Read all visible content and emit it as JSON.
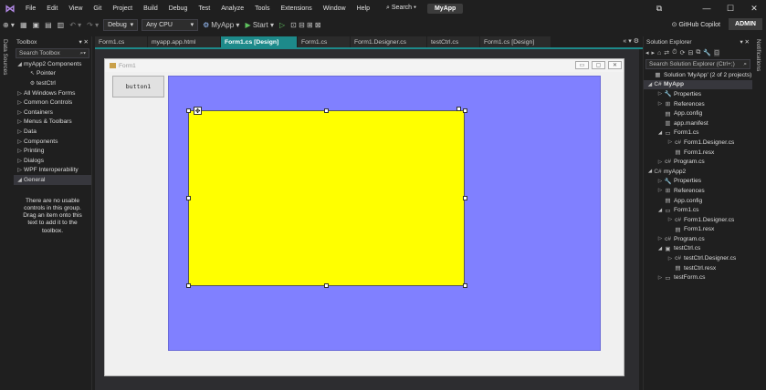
{
  "menu": {
    "items": [
      "File",
      "Edit",
      "View",
      "Git",
      "Project",
      "Build",
      "Debug",
      "Test",
      "Analyze",
      "Tools",
      "Extensions",
      "Window",
      "Help"
    ],
    "search_label": "Search",
    "project_name": "MyApp"
  },
  "toolbar": {
    "config": "Debug",
    "platform": "Any CPU",
    "startup_project": "MyApp",
    "start_label": "Start",
    "copilot_label": "GitHub Copilot",
    "admin_label": "ADMIN"
  },
  "left_strip": {
    "label": "Data Sources"
  },
  "right_strip": {
    "label": "Notifications"
  },
  "toolbox": {
    "title": "Toolbox",
    "search_placeholder": "Search Toolbox",
    "items": [
      {
        "label": "myApp2 Components",
        "expanded": true,
        "indent": 0
      },
      {
        "label": "Pointer",
        "indent": 1
      },
      {
        "label": "testCtrl",
        "indent": 1
      },
      {
        "label": "All Windows Forms",
        "indent": 0
      },
      {
        "label": "Common Controls",
        "indent": 0
      },
      {
        "label": "Containers",
        "indent": 0
      },
      {
        "label": "Menus & Toolbars",
        "indent": 0
      },
      {
        "label": "Data",
        "indent": 0
      },
      {
        "label": "Components",
        "indent": 0
      },
      {
        "label": "Printing",
        "indent": 0
      },
      {
        "label": "Dialogs",
        "indent": 0
      },
      {
        "label": "WPF Interoperability",
        "indent": 0
      },
      {
        "label": "General",
        "indent": 0,
        "expanded": true,
        "selected": true
      }
    ],
    "empty_message": "There are no usable controls in this group. Drag an item onto this text to add it to the toolbox."
  },
  "tabs": [
    {
      "label": "Form1.cs",
      "state": "normal"
    },
    {
      "label": "myapp.app.html",
      "state": "normal"
    },
    {
      "label": "Form1.cs [Design]",
      "state": "active"
    },
    {
      "label": "Form1.cs",
      "state": "normal"
    },
    {
      "label": "Form1.Designer.cs",
      "state": "normal"
    },
    {
      "label": "testCtrl.cs",
      "state": "normal"
    },
    {
      "label": "Form1.cs [Design]",
      "state": "normal"
    }
  ],
  "designer": {
    "form_title": "Form1",
    "button_label": "button1",
    "panel_color": "#8080ff",
    "control_color": "#ffff00"
  },
  "solution_explorer": {
    "title": "Solution Explorer",
    "search_placeholder": "Search Solution Explorer (Ctrl+;)",
    "items": [
      {
        "label": "Solution 'MyApp' (2 of 2 projects)",
        "level": 0,
        "icon": "solution"
      },
      {
        "label": "MyApp",
        "level": 0,
        "arrow": "down",
        "icon": "cs-project",
        "bold": true,
        "selected": true
      },
      {
        "label": "Properties",
        "level": 1,
        "arrow": "right",
        "icon": "wrench"
      },
      {
        "label": "References",
        "level": 1,
        "arrow": "right",
        "icon": "references"
      },
      {
        "label": "App.config",
        "level": 1,
        "icon": "config"
      },
      {
        "label": "app.manifest",
        "level": 1,
        "icon": "manifest"
      },
      {
        "label": "Form1.cs",
        "level": 1,
        "arrow": "down",
        "icon": "form"
      },
      {
        "label": "Form1.Designer.cs",
        "level": 2,
        "arrow": "right",
        "icon": "cs"
      },
      {
        "label": "Form1.resx",
        "level": 2,
        "icon": "resx"
      },
      {
        "label": "Program.cs",
        "level": 1,
        "arrow": "right",
        "icon": "cs"
      },
      {
        "label": "myApp2",
        "level": 0,
        "arrow": "down",
        "icon": "cs-project"
      },
      {
        "label": "Properties",
        "level": 1,
        "arrow": "right",
        "icon": "wrench"
      },
      {
        "label": "References",
        "level": 1,
        "arrow": "right",
        "icon": "references"
      },
      {
        "label": "App.config",
        "level": 1,
        "icon": "config"
      },
      {
        "label": "Form1.cs",
        "level": 1,
        "arrow": "down",
        "icon": "form"
      },
      {
        "label": "Form1.Designer.cs",
        "level": 2,
        "arrow": "right",
        "icon": "cs"
      },
      {
        "label": "Form1.resx",
        "level": 2,
        "icon": "resx"
      },
      {
        "label": "Program.cs",
        "level": 1,
        "arrow": "right",
        "icon": "cs"
      },
      {
        "label": "testCtrl.cs",
        "level": 1,
        "arrow": "down",
        "icon": "usercontrol"
      },
      {
        "label": "testCtrl.Designer.cs",
        "level": 2,
        "arrow": "right",
        "icon": "cs"
      },
      {
        "label": "testCtrl.resx",
        "level": 2,
        "icon": "resx"
      },
      {
        "label": "testForm.cs",
        "level": 1,
        "arrow": "right",
        "icon": "form"
      }
    ]
  }
}
